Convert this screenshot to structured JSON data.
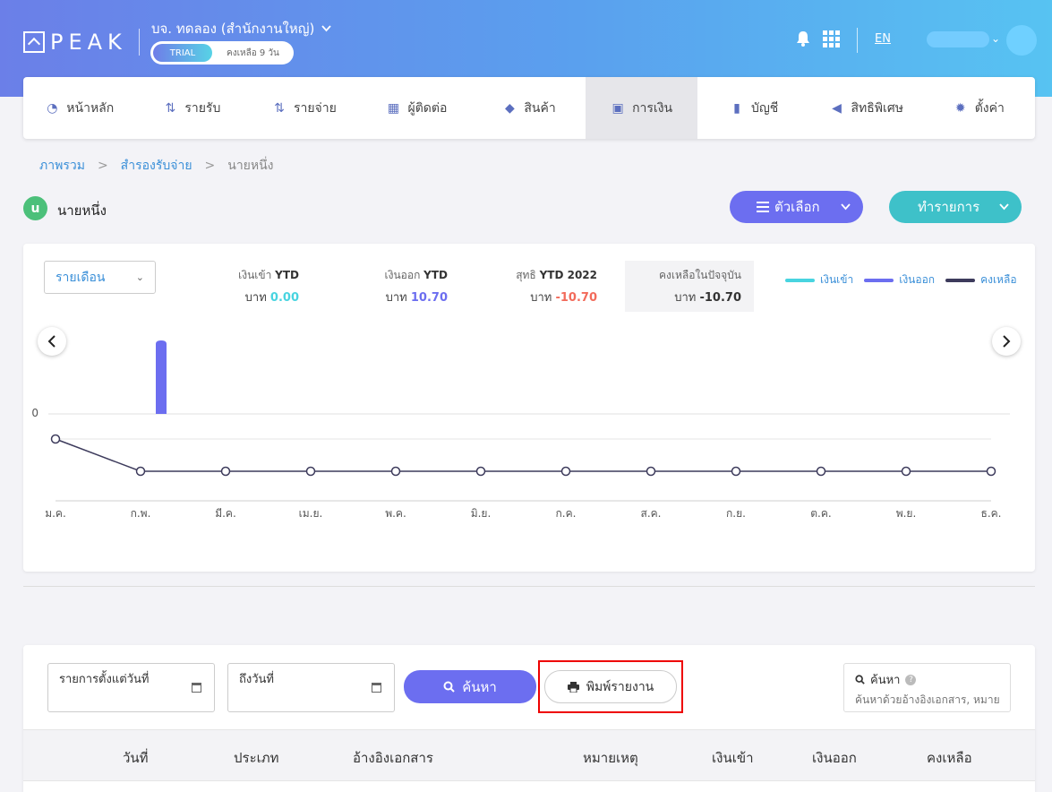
{
  "header": {
    "logo_text": "PEAK",
    "company": "บจ. ทดลอง (สำนักงานใหญ่)",
    "trial_badge": "TRIAL",
    "trial_remaining": "คงเหลือ 9 วัน",
    "language": "EN"
  },
  "nav": {
    "items": [
      {
        "label": "หน้าหลัก",
        "icon": "dashboard-icon"
      },
      {
        "label": "รายรับ",
        "icon": "income-icon"
      },
      {
        "label": "รายจ่าย",
        "icon": "expense-icon"
      },
      {
        "label": "ผู้ติดต่อ",
        "icon": "contacts-icon"
      },
      {
        "label": "สินค้า",
        "icon": "box-icon"
      },
      {
        "label": "การเงิน",
        "icon": "money-icon"
      },
      {
        "label": "บัญชี",
        "icon": "ledger-icon"
      },
      {
        "label": "สิทธิพิเศษ",
        "icon": "megaphone-icon"
      },
      {
        "label": "ตั้งค่า",
        "icon": "gear-icon"
      }
    ],
    "active_index": 5
  },
  "breadcrumb": {
    "items": [
      "ภาพรวม",
      "สำรองรับจ่าย",
      "นายหนึ่ง"
    ],
    "sep": ">"
  },
  "account": {
    "initial": "u",
    "name": "นายหนึ่ง",
    "options_label": "ตัวเลือก",
    "transaction_label": "ทำรายการ"
  },
  "summary": {
    "period": "รายเดือน",
    "income_label": "เงินเข้า",
    "income_tag": "YTD",
    "income_value": "0.00",
    "expense_label": "เงินออก",
    "expense_tag": "YTD",
    "expense_value": "10.70",
    "net_label": "สุทธิ",
    "net_tag": "YTD 2022",
    "net_value": "-10.70",
    "balance_label": "คงเหลือในปัจจุบัน",
    "balance_value": "-10.70",
    "currency": "บาท",
    "colors": {
      "income": "#48d4e0",
      "expense": "#6c6ef0",
      "balance": "#3d3b5c",
      "negative": "#f26b5b"
    }
  },
  "chart_data": {
    "type": "bar",
    "categories": [
      "ม.ค.",
      "ก.พ.",
      "มี.ค.",
      "เม.ย.",
      "พ.ค.",
      "มิ.ย.",
      "ก.ค.",
      "ส.ค.",
      "ก.ย.",
      "ต.ค.",
      "พ.ย.",
      "ธ.ค."
    ],
    "series": [
      {
        "name": "เงินเข้า",
        "type": "bar",
        "values": [
          0,
          0,
          0,
          0,
          0,
          0,
          0,
          0,
          0,
          0,
          0,
          0
        ]
      },
      {
        "name": "เงินออก",
        "type": "bar",
        "values": [
          0,
          10.7,
          0,
          0,
          0,
          0,
          0,
          0,
          0,
          0,
          0,
          0
        ]
      },
      {
        "name": "คงเหลือ",
        "type": "line",
        "values": [
          0,
          -10.7,
          -10.7,
          -10.7,
          -10.7,
          -10.7,
          -10.7,
          -10.7,
          -10.7,
          -10.7,
          -10.7,
          -10.7
        ]
      }
    ],
    "y_ticks": [
      "0"
    ],
    "legend": "top-right"
  },
  "filters": {
    "from_label": "รายการตั้งแต่วันที่",
    "to_label": "ถึงวันที่",
    "search_button": "ค้นหา",
    "print_button": "พิมพ์รายงาน",
    "search_title": "ค้นหา",
    "search_placeholder": "ค้นหาด้วยอ้างอิงเอกสาร, หมาย"
  },
  "table": {
    "columns": [
      "วันที่",
      "ประเภท",
      "อ้างอิงเอกสาร",
      "หมายเหตุ",
      "เงินเข้า",
      "เงินออก",
      "คงเหลือ"
    ]
  }
}
